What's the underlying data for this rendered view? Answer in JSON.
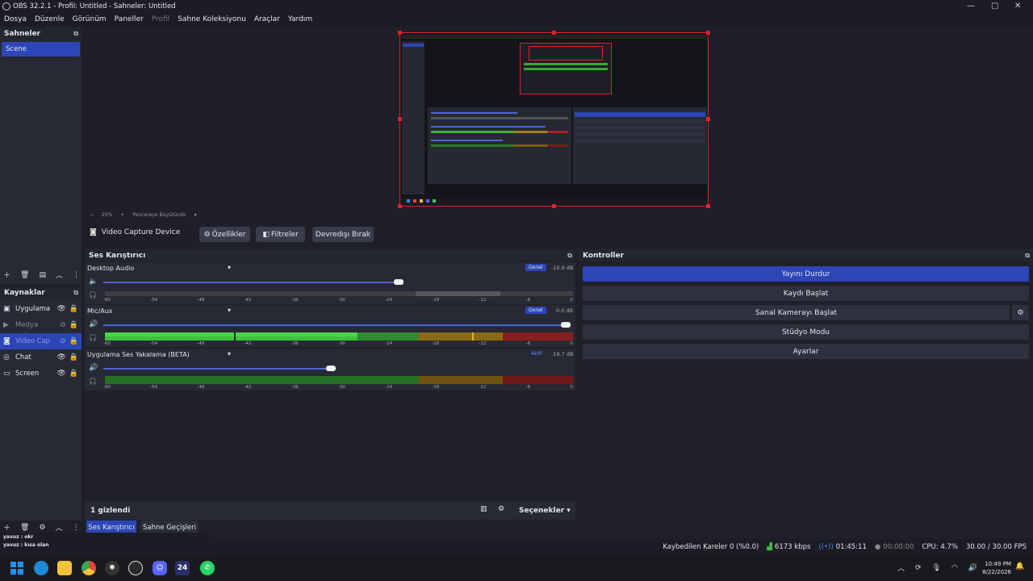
{
  "window": {
    "title": "OBS 32.2.1 - Profil: Untitled - Sahneler: Untitled"
  },
  "menu": [
    {
      "label": "Dosya",
      "dim": false
    },
    {
      "label": "Düzenle",
      "dim": false
    },
    {
      "label": "Görünüm",
      "dim": false
    },
    {
      "label": "Paneller",
      "dim": false
    },
    {
      "label": "Profil",
      "dim": true
    },
    {
      "label": "Sahne Koleksiyonu",
      "dim": false
    },
    {
      "label": "Araçlar",
      "dim": false
    },
    {
      "label": "Yardım",
      "dim": false
    }
  ],
  "scenes": {
    "title": "Sahneler",
    "items": [
      "Scene"
    ]
  },
  "sources": {
    "title": "Kaynaklar",
    "items": [
      {
        "label": "Uygulama",
        "icon": "window-icon",
        "visible": true,
        "selected": false
      },
      {
        "label": "Medya",
        "icon": "play-icon",
        "visible": false,
        "selected": false
      },
      {
        "label": "Video Cap",
        "icon": "camera-icon",
        "visible": false,
        "selected": true
      },
      {
        "label": "Chat",
        "icon": "globe-icon",
        "visible": true,
        "selected": false
      },
      {
        "label": "Screen",
        "icon": "monitor-icon",
        "visible": true,
        "selected": false
      }
    ]
  },
  "preview_bar": {
    "zoom": "25%",
    "fit_label": "Pencereye Büyütündir"
  },
  "source_toolbar": {
    "source_name": "Video Capture Device",
    "properties": "Özellikler",
    "filters": "Filtreler",
    "deactivate": "Devredışı Bırak"
  },
  "mixer": {
    "title": "Ses Karıştırıcı",
    "scale": [
      "-60",
      "-54",
      "-48",
      "-42",
      "-36",
      "-30",
      "-24",
      "-18",
      "-12",
      "-6",
      "0"
    ],
    "channels": [
      {
        "name": "Desktop Audio",
        "badge": "Genel",
        "db": "-10.9 dB",
        "fader": 0.6,
        "muted": true,
        "level": 0.0
      },
      {
        "name": "Mic/Aux",
        "badge": "Genel",
        "db": "0.0 dB",
        "fader": 1.0,
        "muted": false,
        "level": 0.55
      },
      {
        "name": "Uygulama Ses Yakalama (BETA)",
        "badge": "Aktif",
        "db": "-19.7 dB",
        "fader": 0.45,
        "muted": false,
        "level": 0.0
      }
    ],
    "hidden_label": "1 gizlendi",
    "options_label": "Seçenekler"
  },
  "controls": {
    "title": "Kontroller",
    "buttons": [
      "Yayını Durdur",
      "Kaydı Başlat",
      "Sanal Kamerayı Başlat",
      "Stüdyo Modu",
      "Ayarlar"
    ]
  },
  "bottom_tabs": [
    "Ses Karıştırıcı",
    "Sahne Geçişleri"
  ],
  "chat": [
    "yavuz : okr",
    "yavuz : kısa olan"
  ],
  "statusbar": {
    "dropped": "Kaybedilen Kareler 0 (%0.0)",
    "bitrate": "6173 kbps",
    "stream_time": "01:45:11",
    "rec_time": "00:00:00",
    "cpu": "CPU: 4.7%",
    "fps": "30.00 / 30.00 FPS"
  },
  "taskbar": {
    "time": "10:49 PM",
    "date": "8/22/2026",
    "apps": [
      {
        "name": "windows-start-icon",
        "color": "#1e90ff"
      },
      {
        "name": "edge-icon",
        "color": "#1b8bd6"
      },
      {
        "name": "file-explorer-icon",
        "color": "#f3c13a"
      },
      {
        "name": "chrome-icon",
        "color": "#e04a3a"
      },
      {
        "name": "chatgpt-icon",
        "color": "#333333"
      },
      {
        "name": "obs-icon",
        "color": "#2a2a2a"
      },
      {
        "name": "discord-icon",
        "color": "#5865f2"
      },
      {
        "name": "app-24-icon",
        "color": "#2b2f6a"
      },
      {
        "name": "whatsapp-icon",
        "color": "#25d366"
      }
    ],
    "app_24_label": "24"
  }
}
